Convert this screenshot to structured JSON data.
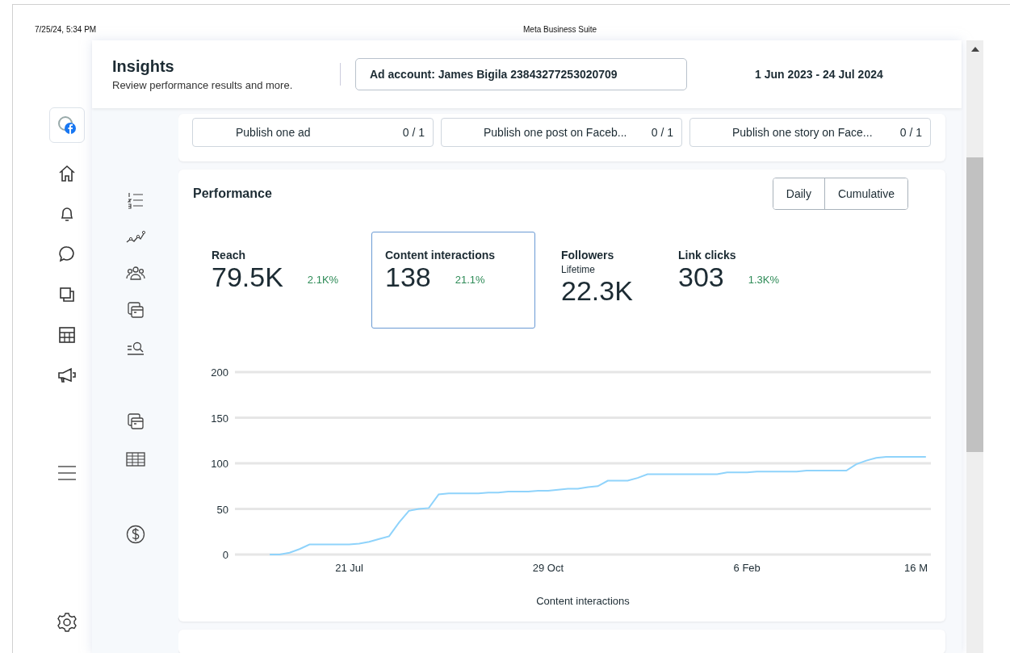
{
  "print_header": {
    "date": "7/25/24, 5:34 PM",
    "title": "Meta Business Suite"
  },
  "header": {
    "title": "Insights",
    "subtitle": "Review performance results and more.",
    "account": "Ad account: James Bigila 23843277253020709",
    "date_range": "1 Jun 2023 - 24 Jul 2024"
  },
  "tasks": [
    {
      "label": "Publish one ad",
      "progress": "0 / 1"
    },
    {
      "label": "Publish one post on Faceb...",
      "progress": "0 / 1"
    },
    {
      "label": "Publish one story on Face...",
      "progress": "0 / 1"
    }
  ],
  "performance": {
    "title": "Performance",
    "toggle": [
      "Daily",
      "Cumulative"
    ],
    "metrics": [
      {
        "name": "Reach",
        "value": "79.5K",
        "change": "2.1K%",
        "selected": false
      },
      {
        "name": "Content interactions",
        "value": "138",
        "change": "21.1%",
        "selected": true
      },
      {
        "name": "Followers",
        "subtitle": "Lifetime",
        "value": "22.3K",
        "selected": false
      },
      {
        "name": "Link clicks",
        "value": "303",
        "change": "1.3K%",
        "selected": false
      }
    ],
    "chart_data": {
      "type": "line",
      "grid": true,
      "xlabel": "Content interactions",
      "ylim": [
        0,
        200
      ],
      "yticks": [
        0,
        50,
        100,
        150,
        200
      ],
      "categories": [
        null,
        null,
        null,
        null,
        null,
        null,
        null,
        null,
        null,
        null,
        null,
        "21 Jul",
        null,
        null,
        null,
        null,
        null,
        null,
        null,
        null,
        null,
        null,
        null,
        null,
        null,
        null,
        null,
        null,
        null,
        null,
        null,
        "29 Oct",
        null,
        null,
        null,
        null,
        null,
        null,
        null,
        null,
        null,
        null,
        null,
        null,
        null,
        null,
        null,
        null,
        null,
        null,
        null,
        "6 Feb",
        null,
        null,
        null,
        null,
        null,
        null,
        null,
        null,
        null,
        null,
        null,
        null,
        null,
        null,
        null,
        null,
        "16 M",
        null
      ],
      "series": [
        {
          "color": "#8fd3fb",
          "values": [
            null,
            null,
            null,
            0,
            0,
            2,
            6,
            11,
            11,
            11,
            11,
            11,
            12,
            14,
            17,
            20,
            35,
            48,
            50,
            51,
            66,
            67,
            67,
            67,
            67,
            68,
            68,
            69,
            69,
            69,
            70,
            70,
            71,
            72,
            72,
            74,
            75,
            81,
            81,
            81,
            84,
            88,
            88,
            88,
            88,
            88,
            88,
            88,
            88,
            90,
            90,
            90,
            91,
            91,
            91,
            91,
            91,
            92,
            92,
            92,
            92,
            92,
            99,
            103,
            106,
            107,
            107,
            107,
            107,
            107
          ]
        }
      ]
    }
  }
}
